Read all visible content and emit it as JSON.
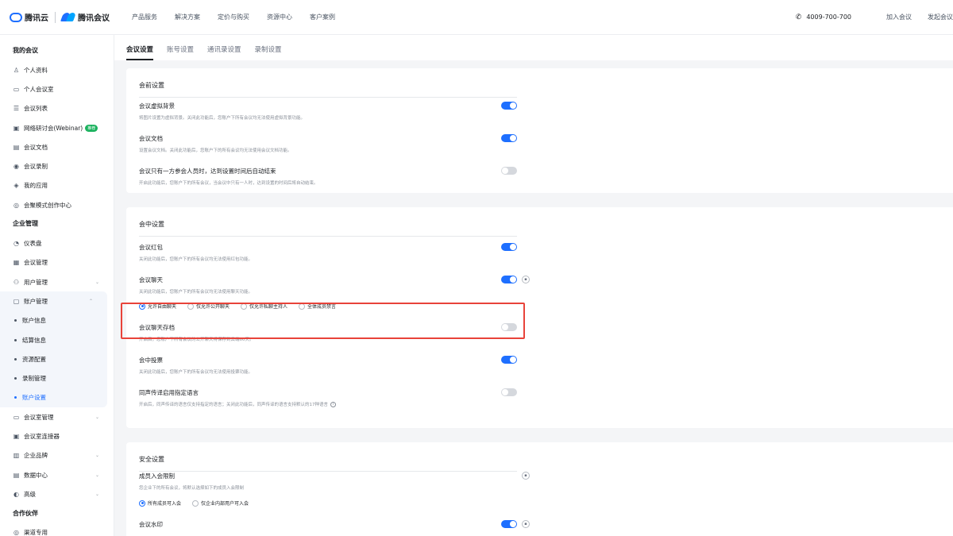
{
  "brand": {
    "cloud": "腾讯云",
    "meeting": "腾讯会议"
  },
  "topnav": {
    "links": [
      "产品服务",
      "解决方案",
      "定价与购买",
      "资源中心",
      "客户案例"
    ],
    "phone": "4009-700-700",
    "join": "加入会议",
    "start": "发起会议"
  },
  "sidebar": {
    "groups": {
      "my": "我的会议",
      "enterprise": "企业管理",
      "partner": "合作伙伴"
    },
    "my_items": [
      {
        "label": "个人资料",
        "icon": "user-icon"
      },
      {
        "label": "个人会议室",
        "icon": "monitor-icon"
      },
      {
        "label": "会议列表",
        "icon": "list-icon"
      },
      {
        "label": "网络研讨会(Webinar)",
        "icon": "webinar-icon",
        "badge": "推荐"
      },
      {
        "label": "会议文档",
        "icon": "document-icon"
      },
      {
        "label": "会议录制",
        "icon": "record-icon"
      },
      {
        "label": "我的应用",
        "icon": "apps-icon"
      },
      {
        "label": "会聚模式创作中心",
        "icon": "create-icon"
      }
    ],
    "enterprise_items": {
      "dashboard": "仪表盘",
      "meeting_mgmt": "会议管理",
      "user_mgmt": "用户管理",
      "account_mgmt": "账户管理",
      "account_sub": [
        "账户信息",
        "结算信息",
        "资源配置",
        "录制管理",
        "账户设置"
      ],
      "room_mgmt": "会议室管理",
      "room_connector": "会议室连接器",
      "brand": "企业品牌",
      "data_center": "数据中心",
      "advanced": "高级"
    },
    "partner_items": {
      "channel": "渠道专用"
    }
  },
  "tabs": [
    "会议设置",
    "账号设置",
    "通讯录设置",
    "录制设置"
  ],
  "pre_meeting": {
    "title": "会前设置",
    "settings": [
      {
        "name": "会议虚拟背景",
        "desc": "将图片设置为虚拟背景。关闭此功能后，您账户下所有会议均无法使用虚拟背景功能。",
        "on": true
      },
      {
        "name": "会议文档",
        "desc": "设置会议文档。关闭此功能后，您账户下的所有会议均无法使用会议文档功能。",
        "on": true
      },
      {
        "name": "会议只有一方参会人员时，达到设置时间后自动结束",
        "desc": "开启此功能后，您账户下的所有会议，当会议中只有一人时，达到设置的时间后将自动结束。",
        "on": false
      }
    ]
  },
  "in_meeting": {
    "title": "会中设置",
    "red_packet": {
      "name": "会议红包",
      "desc": "关闭此功能后，您账户下的所有会议均无法使用红包功能。",
      "on": true
    },
    "chat": {
      "name": "会议聊天",
      "desc": "关闭此功能后，您账户下的所有会议均无法使用聊天功能。",
      "on": true,
      "options": [
        "允许自由聊天",
        "仅允许公开聊天",
        "仅允许私聊主持人",
        "全体成员禁言"
      ],
      "selected": 0
    },
    "chat_archive": {
      "name": "会议聊天存档",
      "desc": "开启后，您账户下所有会议的公开聊天将保存到云端60天。",
      "on": false
    },
    "vote": {
      "name": "会中投票",
      "desc": "关闭此功能后，您账户下的所有会议均无法使用投票功能。",
      "on": true
    },
    "interpretation": {
      "name": "同声传译启用指定语言",
      "desc": "开启后，同声传译的语言仅支持指定的语言；关闭此功能后，同声传译的语言支持默认的17种语言",
      "on": false
    }
  },
  "security": {
    "title": "安全设置",
    "member_restrict": {
      "name": "成员入会限制",
      "desc": "您企业下的所有会议，将默认选择如下的成员入会限制",
      "options": [
        "所有成员可入会",
        "仅企业内部用户可入会"
      ],
      "selected": 0
    },
    "watermark": {
      "name": "会议水印",
      "on": true
    }
  },
  "colors": {
    "accent": "#1e6fff",
    "highlight": "#e8433a",
    "badge": "#1bb25e"
  }
}
